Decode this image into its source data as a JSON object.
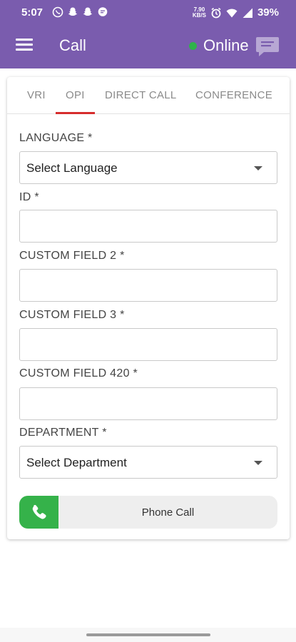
{
  "status_bar": {
    "time": "5:07",
    "net_speed_top": "7.90",
    "net_speed_bottom": "KB/S",
    "battery": "39%"
  },
  "app_bar": {
    "title": "Call",
    "status_text": "Online",
    "status_color": "#2fb24a",
    "bar_color": "#7a5cae"
  },
  "tabs": [
    {
      "label": "VRI"
    },
    {
      "label": "OPI",
      "active": true
    },
    {
      "label": "DIRECT CALL"
    },
    {
      "label": "CONFERENCE"
    }
  ],
  "form": {
    "language_label": "LANGUAGE *",
    "language_value": "Select Language",
    "id_label": "ID *",
    "id_value": "",
    "custom2_label": "CUSTOM FIELD 2 *",
    "custom2_value": "",
    "custom3_label": "CUSTOM FIELD 3 *",
    "custom3_value": "",
    "custom420_label": "CUSTOM FIELD 420 *",
    "custom420_value": "",
    "department_label": "DEPARTMENT *",
    "department_value": "Select Department"
  },
  "phone_call_label": "Phone Call",
  "accent_colors": {
    "tab_indicator": "#d62d2d",
    "phone_button": "#35b24a"
  }
}
